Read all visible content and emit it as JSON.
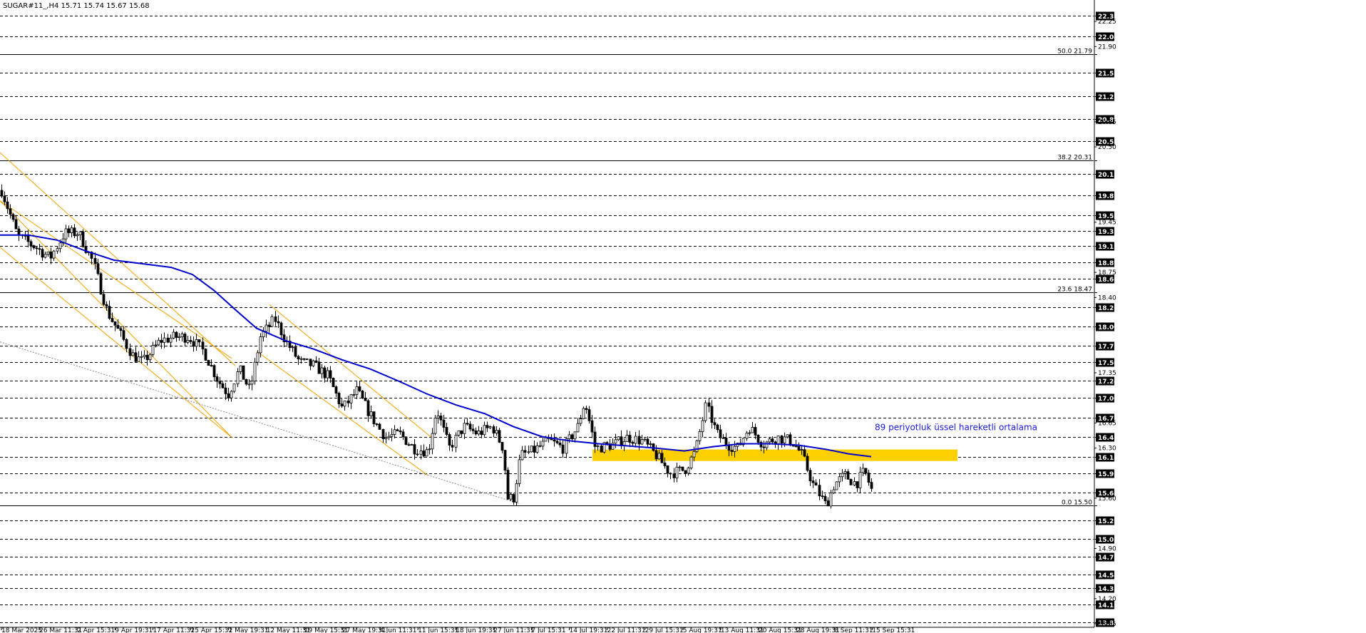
{
  "header": {
    "title": "SUGAR#11_,H4  15.71 15.74 15.67 15.68"
  },
  "colors": {
    "background": "#ffffff",
    "candle": "#000000",
    "ema": "#0000cc",
    "channel": "#f5a300",
    "zone": "#ffd000",
    "dashed_level": "#000000",
    "label_bg": "#000000",
    "label_text": "#ffffff",
    "note": "#1a1ad8"
  },
  "chart_data": {
    "type": "candlestick",
    "symbol": "SUGAR#11_",
    "timeframe": "H4",
    "ohlc_header": {
      "open": 15.71,
      "high": 15.74,
      "low": 15.67,
      "close": 15.68
    },
    "ylim": [
      13.8,
      22.48
    ],
    "current_price": 15.68,
    "x_ticks": [
      "18 Mar 2025",
      "26 Mar 11:31",
      "2 Apr 15:31",
      "9 Apr 19:31",
      "17 Apr 11:31",
      "25 Apr 15:31",
      "2 May 19:31",
      "12 May 11:31",
      "19 May 15:31",
      "27 May 19:31",
      "4 Jun 11:31",
      "11 Jun 15:31",
      "18 Jun 19:31",
      "27 Jun 11:31",
      "7 Jul 15:31",
      "14 Jul 19:31",
      "22 Jul 11:31",
      "29 Jul 15:31",
      "5 Aug 19:31",
      "13 Aug 11:31",
      "20 Aug 15:31",
      "28 Aug 19:31",
      "8 Sep 11:31",
      "15 Sep 15:31"
    ],
    "y_ticks": [
      "22.25",
      "21.90",
      "20.85",
      "20.50",
      "19.45",
      "18.75",
      "18.40",
      "17.35",
      "16.65",
      "16.30",
      "15.60",
      "14.90",
      "14.20",
      "13.85"
    ],
    "highlighted_levels": [
      "22.33",
      "22.04",
      "21.79",
      "21.53",
      "21.21",
      "20.89",
      "20.58",
      "20.31",
      "20.12",
      "19.82",
      "19.55",
      "19.33",
      "19.12",
      "18.89",
      "18.66",
      "18.47",
      "18.26",
      "18.00",
      "17.73",
      "17.50",
      "17.24",
      "17.00",
      "16.72",
      "16.45",
      "16.18",
      "15.95",
      "15.68",
      "15.50",
      "15.29",
      "15.03",
      "14.78",
      "14.54",
      "14.35",
      "14.12",
      "13.87"
    ],
    "fibonacci_levels": [
      {
        "label": "50.0 21.79",
        "price": 21.79
      },
      {
        "label": "38.2 20.31",
        "price": 20.31
      },
      {
        "label": "23.6 18.47",
        "price": 18.47
      },
      {
        "label": "0.0 15.50",
        "price": 15.5
      }
    ],
    "anchors": [
      [
        0,
        19.95
      ],
      [
        25,
        19.25
      ],
      [
        50,
        19.1
      ],
      [
        70,
        18.95
      ],
      [
        90,
        19.3
      ],
      [
        110,
        19.3
      ],
      [
        130,
        18.9
      ],
      [
        150,
        18.2
      ],
      [
        165,
        17.95
      ],
      [
        185,
        17.6
      ],
      [
        200,
        17.5
      ],
      [
        225,
        17.8
      ],
      [
        245,
        17.85
      ],
      [
        265,
        17.85
      ],
      [
        285,
        17.65
      ],
      [
        305,
        17.25
      ],
      [
        320,
        17.05
      ],
      [
        335,
        17.4
      ],
      [
        350,
        17.1
      ],
      [
        365,
        17.85
      ],
      [
        385,
        18.1
      ],
      [
        400,
        17.8
      ],
      [
        420,
        17.5
      ],
      [
        440,
        17.45
      ],
      [
        460,
        17.3
      ],
      [
        480,
        16.85
      ],
      [
        500,
        17.1
      ],
      [
        520,
        16.75
      ],
      [
        540,
        16.45
      ],
      [
        560,
        16.5
      ],
      [
        580,
        16.3
      ],
      [
        600,
        16.25
      ],
      [
        612,
        16.85
      ],
      [
        630,
        16.3
      ],
      [
        650,
        16.6
      ],
      [
        670,
        16.5
      ],
      [
        690,
        16.6
      ],
      [
        705,
        16.3
      ],
      [
        712,
        15.6
      ],
      [
        720,
        15.6
      ],
      [
        730,
        16.2
      ],
      [
        745,
        16.25
      ],
      [
        770,
        16.4
      ],
      [
        790,
        16.3
      ],
      [
        810,
        16.6
      ],
      [
        820,
        16.95
      ],
      [
        835,
        16.3
      ],
      [
        860,
        16.35
      ],
      [
        880,
        16.45
      ],
      [
        900,
        16.4
      ],
      [
        920,
        16.2
      ],
      [
        940,
        15.95
      ],
      [
        960,
        16.0
      ],
      [
        975,
        16.25
      ],
      [
        990,
        16.9
      ],
      [
        1005,
        16.5
      ],
      [
        1020,
        16.35
      ],
      [
        1035,
        16.3
      ],
      [
        1050,
        16.6
      ],
      [
        1070,
        16.35
      ],
      [
        1090,
        16.45
      ],
      [
        1110,
        16.4
      ],
      [
        1125,
        16.2
      ],
      [
        1140,
        15.8
      ],
      [
        1158,
        15.5
      ],
      [
        1170,
        15.8
      ],
      [
        1185,
        15.92
      ],
      [
        1200,
        15.8
      ],
      [
        1212,
        15.98
      ],
      [
        1222,
        15.72
      ]
    ],
    "candles_count": 300,
    "ema": {
      "name": "89 periyotluk üssel hareketli ortalama",
      "period": 89,
      "points": [
        [
          0,
          19.27
        ],
        [
          40,
          19.27
        ],
        [
          80,
          19.2
        ],
        [
          120,
          19.05
        ],
        [
          160,
          18.92
        ],
        [
          200,
          18.87
        ],
        [
          240,
          18.82
        ],
        [
          270,
          18.72
        ],
        [
          300,
          18.5
        ],
        [
          330,
          18.23
        ],
        [
          360,
          17.97
        ],
        [
          400,
          17.8
        ],
        [
          440,
          17.68
        ],
        [
          480,
          17.53
        ],
        [
          520,
          17.4
        ],
        [
          560,
          17.23
        ],
        [
          600,
          17.05
        ],
        [
          640,
          16.9
        ],
        [
          680,
          16.78
        ],
        [
          720,
          16.6
        ],
        [
          760,
          16.46
        ],
        [
          800,
          16.4
        ],
        [
          840,
          16.36
        ],
        [
          880,
          16.33
        ],
        [
          920,
          16.3
        ],
        [
          960,
          16.26
        ],
        [
          1000,
          16.32
        ],
        [
          1040,
          16.36
        ],
        [
          1080,
          16.36
        ],
        [
          1120,
          16.34
        ],
        [
          1160,
          16.28
        ],
        [
          1190,
          16.22
        ],
        [
          1222,
          16.18
        ]
      ]
    },
    "support_zone": {
      "x_start": 831,
      "x_end": 1343,
      "price_low": 16.12,
      "price_high": 16.28
    },
    "channels": [
      {
        "upper": [
          [
            0,
            20.42
          ],
          [
            330,
            17.45
          ]
        ],
        "lower": [
          [
            0,
            19.1
          ],
          [
            325,
            16.45
          ]
        ]
      },
      {
        "upper": [
          [
            0,
            19.75
          ],
          [
            325,
            17.55
          ]
        ],
        "lower": [
          [
            0,
            19.75
          ],
          [
            325,
            16.45
          ]
        ]
      },
      {
        "upper": [
          [
            378,
            18.3
          ],
          [
            605,
            16.45
          ]
        ],
        "lower": [
          [
            360,
            17.65
          ],
          [
            600,
            15.92
          ]
        ]
      }
    ],
    "trendline": {
      "points": [
        [
          0,
          17.78
        ],
        [
          730,
          15.52
        ]
      ],
      "style": "dotted"
    },
    "annotation": {
      "text": "89 periyotluk üssel hareketli ortalama",
      "x": 1227,
      "price": 16.55
    }
  }
}
